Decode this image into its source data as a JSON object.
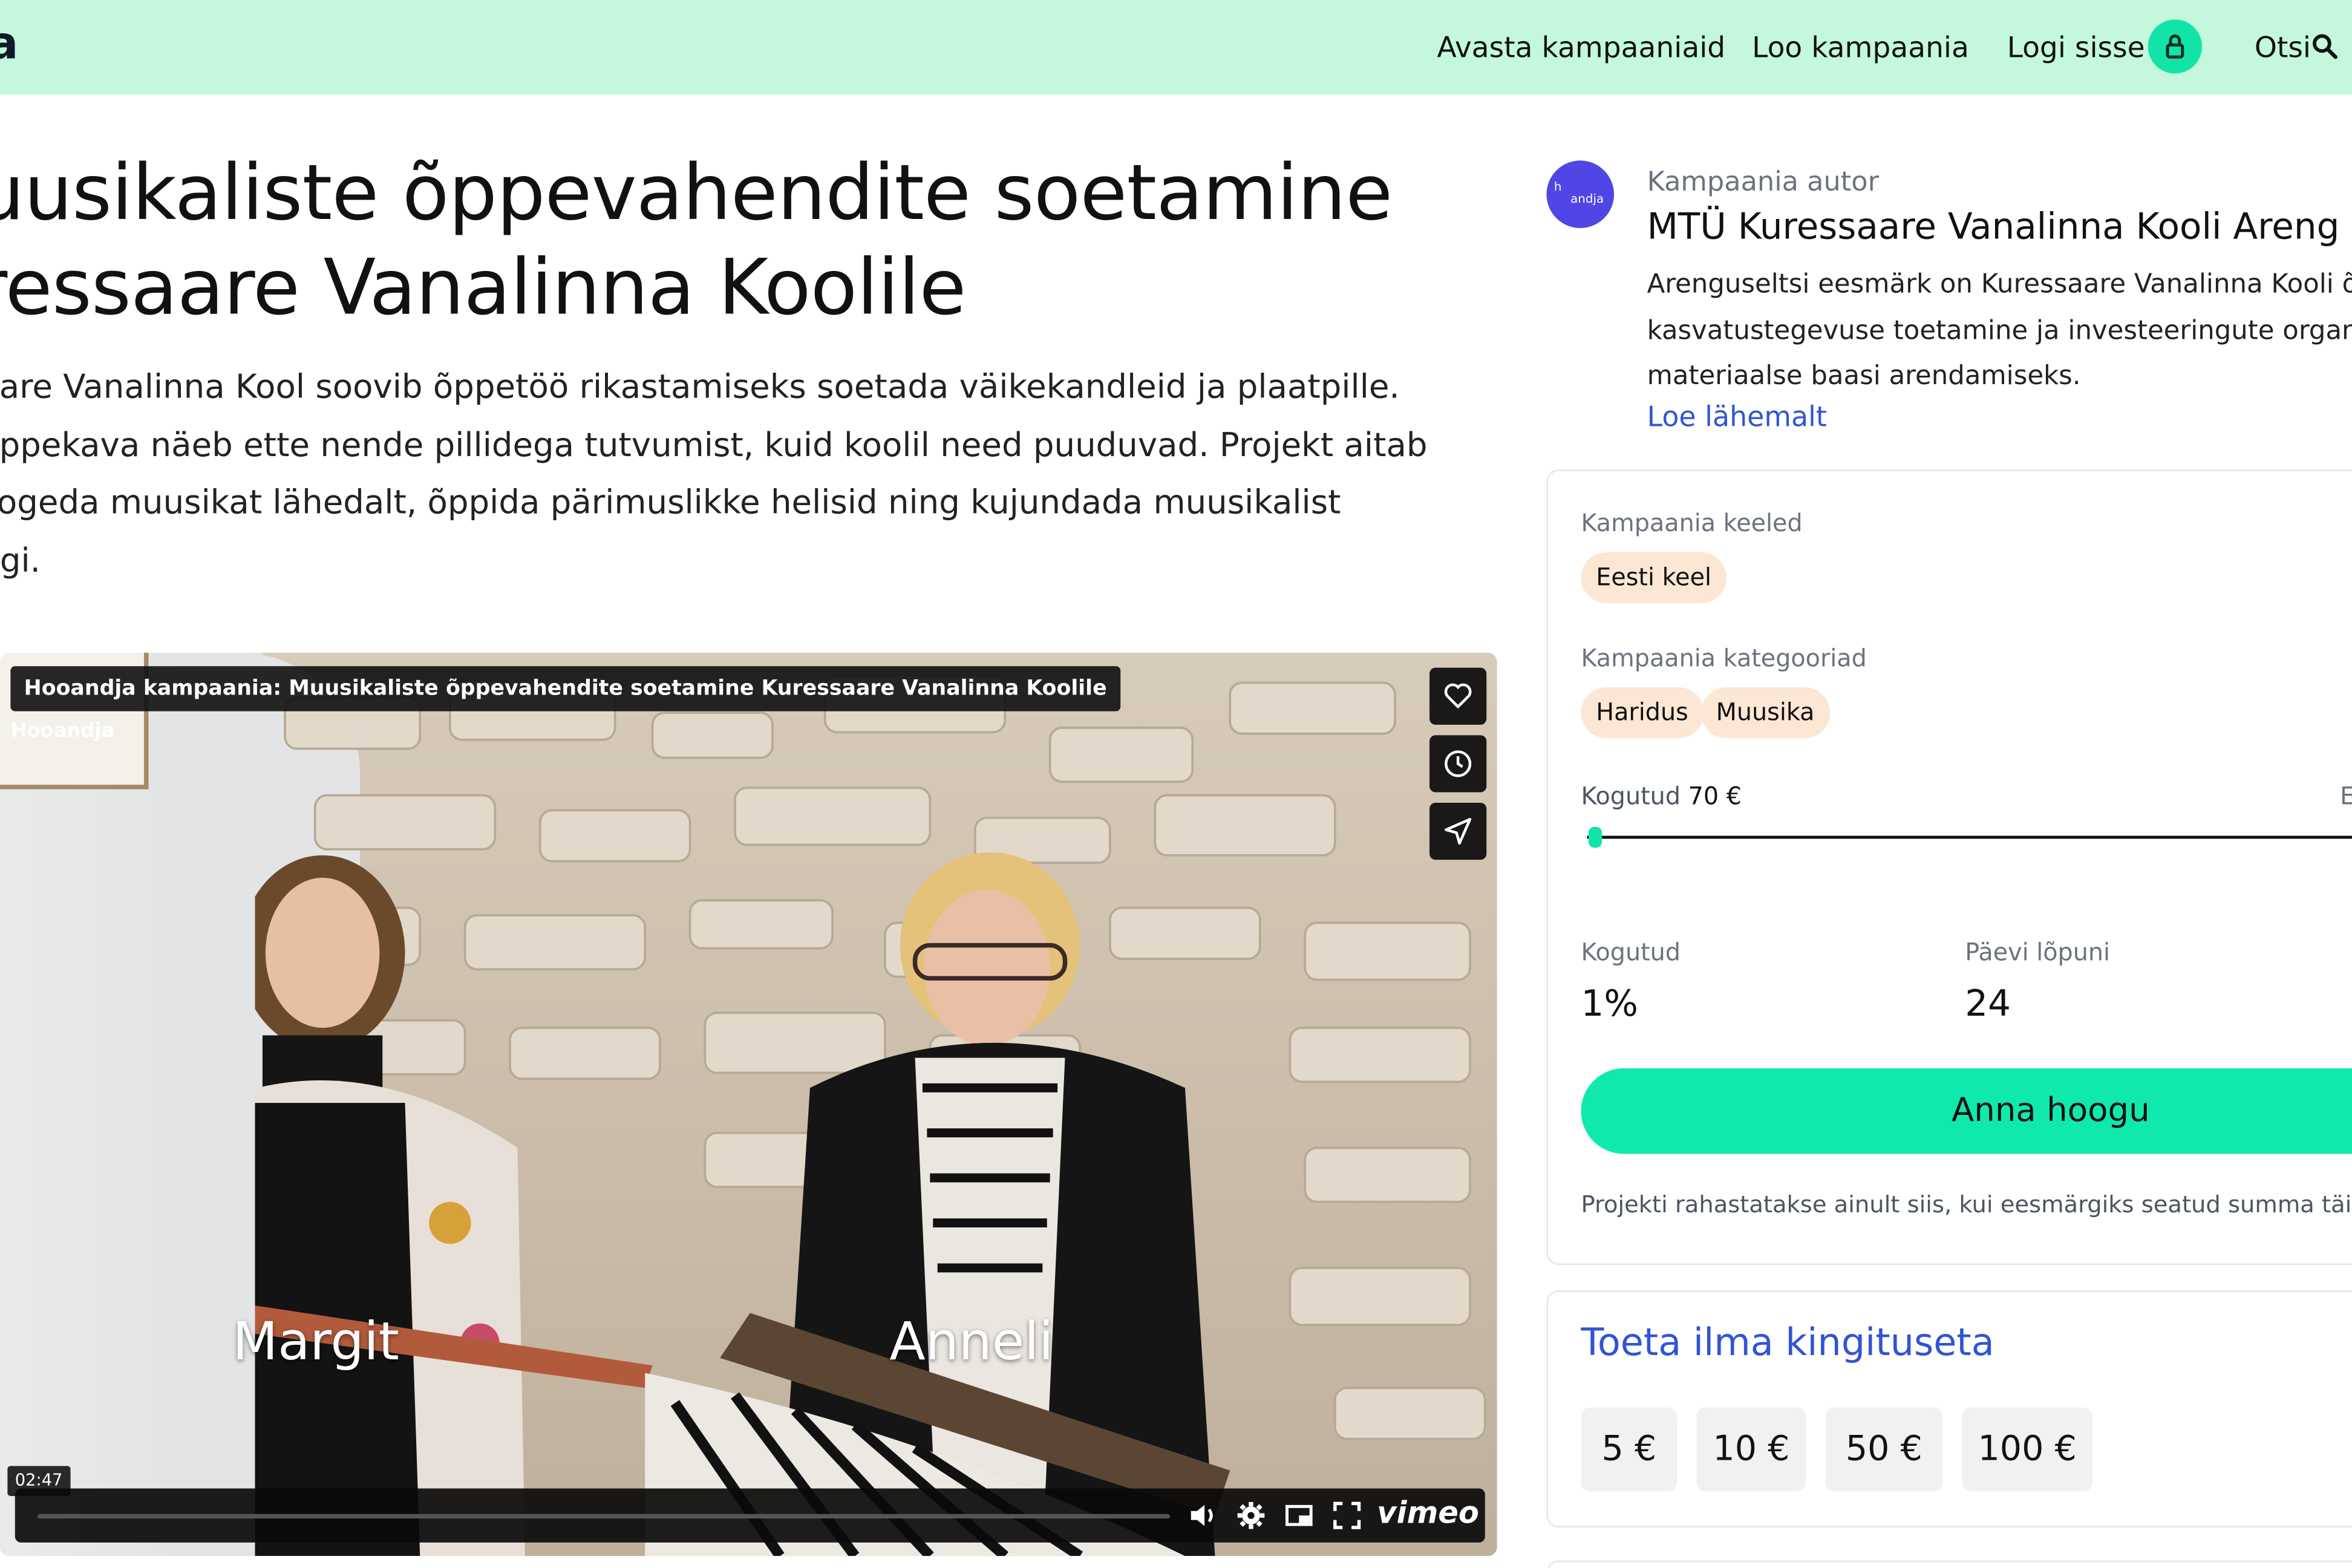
{
  "header": {
    "logo_text": "a",
    "nav": [
      "Avasta kampaaniaid",
      "Loo kampaania",
      "Logi sisse",
      "Otsi"
    ],
    "icons": [
      "lock-icon",
      "search-icon"
    ]
  },
  "campaign": {
    "title_line1": "uusikaliste õppevahendite soetamine",
    "title_line2": "ressaare Vanalinna Koolile",
    "description": [
      "aare Vanalinna Kool soovib õppetöö rikastamiseks soetada väikekandleid ja plaatpille.",
      "õppekava näeb ette nende pillidega tutvumist, kuid koolil need puuduvad. Projekt aitab",
      "kogeda muusikat lähedalt, õppida pärimuslikke helisid ning kujundada muusikalist",
      "ngi."
    ]
  },
  "video": {
    "title": "Hooandja kampaania: Muusikaliste õppevahendite soetamine Kuressaare Vanalinna Koolile",
    "brand": "Hooandja",
    "name_left": "Margit",
    "name_right": "Anneli",
    "time": "02:47",
    "player_brand": "vimeo",
    "side_icons": [
      "heart-icon",
      "clock-icon",
      "send-icon"
    ],
    "control_icons": [
      "volume-icon",
      "settings-icon",
      "pip-icon",
      "fullscreen-icon"
    ]
  },
  "author": {
    "label": "Kampaania autor",
    "name": "MTÜ Kuressaare Vanalinna Kooli Areng",
    "description": [
      "Arenguseltsi eesmärk on Kuressaare Vanalinna Kooli õ",
      "kasvatustegevuse toetamine ja investeeringute organ",
      "materiaalse baasi arendamiseks."
    ],
    "read_more": "Loe lähemalt"
  },
  "stats": {
    "languages_label": "Kampaania keeled",
    "languages": [
      "Eesti keel"
    ],
    "categories_label": "Kampaania kategooriad",
    "categories": [
      "Haridus",
      "Muusika"
    ],
    "collected_label": "Kogutud",
    "collected_amount": "70 €",
    "goal_edge_text": "E",
    "progress_fraction": 0.01,
    "percent_label": "Kogutud",
    "percent_value": "1%",
    "days_label": "Päevi lõpuni",
    "days_value": "24",
    "cta_label": "Anna hoogu",
    "note": "Projekti rahastatakse ainult siis, kui eesmärgiks seatud summa täitul"
  },
  "donate": {
    "title": "Toeta ilma kingituseta",
    "amounts": [
      "5 €",
      "10 €",
      "50 €",
      "100 €"
    ]
  },
  "colors": {
    "header_bg": "#c3f8dd",
    "accent_green": "#10e9ad",
    "link_blue": "#2f55d4",
    "chip_bg": "#fbe7d3"
  }
}
